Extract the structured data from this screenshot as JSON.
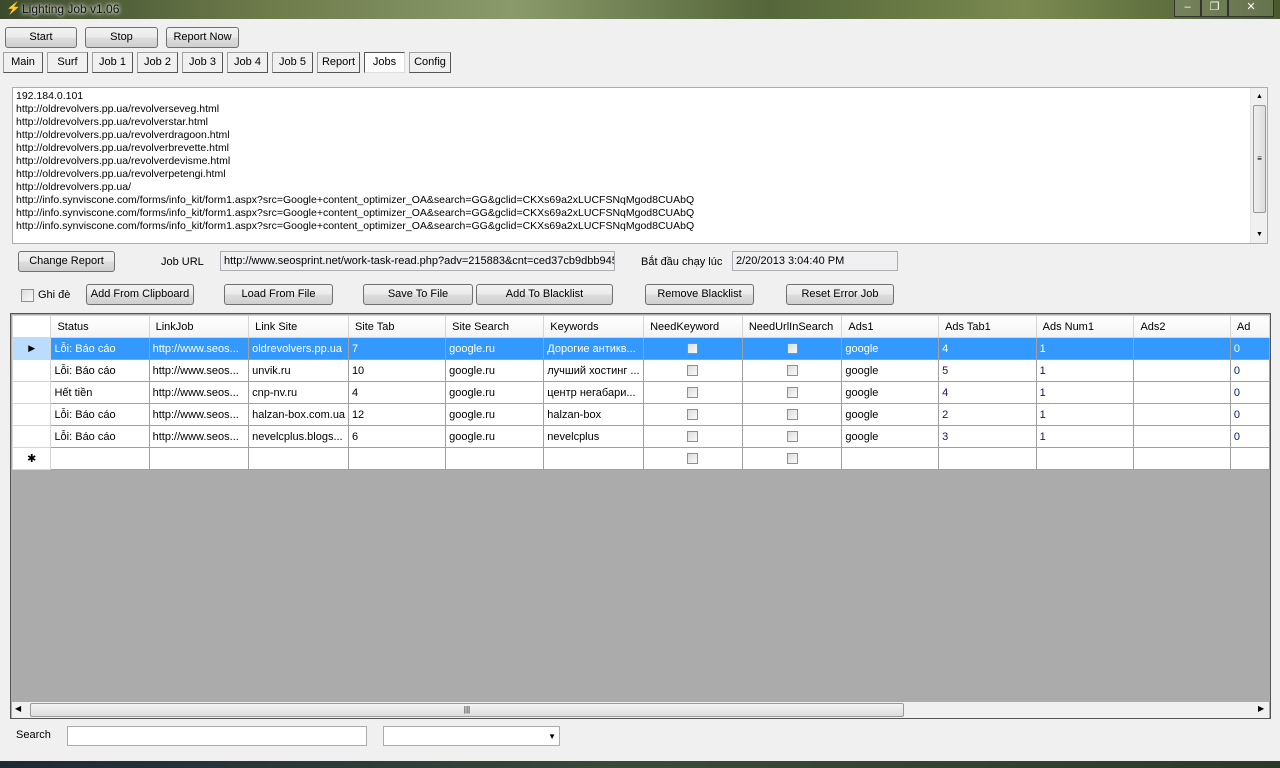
{
  "window": {
    "title": "Lighting Job v1.06",
    "min": "–",
    "max": "❐",
    "close": "✕"
  },
  "toolbar": {
    "start": "Start",
    "stop": "Stop",
    "report_now": "Report Now"
  },
  "tabs": [
    "Main",
    "Surf",
    "Job 1",
    "Job 2",
    "Job 3",
    "Job 4",
    "Job 5",
    "Report",
    "Jobs",
    "Config"
  ],
  "active_tab": "Jobs",
  "log_lines": [
    "192.184.0.101",
    "http://oldrevolvers.pp.ua/revolverseveg.html",
    "http://oldrevolvers.pp.ua/revolverstar.html",
    "http://oldrevolvers.pp.ua/revolverdragoon.html",
    "http://oldrevolvers.pp.ua/revolverbrevette.html",
    "http://oldrevolvers.pp.ua/revolverdevisme.html",
    "http://oldrevolvers.pp.ua/revolverpetengi.html",
    "http://oldrevolvers.pp.ua/",
    "http://info.synviscone.com/forms/info_kit/form1.aspx?src=Google+content_optimizer_OA&search=GG&gclid=CKXs69a2xLUCFSNqMgod8CUAbQ",
    "http://info.synviscone.com/forms/info_kit/form1.aspx?src=Google+content_optimizer_OA&search=GG&gclid=CKXs69a2xLUCFSNqMgod8CUAbQ",
    "http://info.synviscone.com/forms/info_kit/form1.aspx?src=Google+content_optimizer_OA&search=GG&gclid=CKXs69a2xLUCFSNqMgod8CUAbQ"
  ],
  "controls": {
    "change_report": "Change Report",
    "job_url_label": "Job URL",
    "job_url_value": "http://www.seosprint.net/work-task-read.php?adv=215883&cnt=ced37cb9dbb945",
    "start_label": "Bắt đầu chạy lúc",
    "start_value": "2/20/2013 3:04:40 PM",
    "overwrite_label": "Ghi đè",
    "add_clipboard": "Add From Clipboard",
    "load_file": "Load From File",
    "save_file": "Save To File",
    "add_blacklist": "Add To Blacklist",
    "remove_blacklist": "Remove Blacklist",
    "reset_error": "Reset Error Job"
  },
  "grid": {
    "columns": [
      "Status",
      "LinkJob",
      "Link Site",
      "Site Tab",
      "Site Search",
      "Keywords",
      "NeedKeyword",
      "NeedUrlInSearch",
      "Ads1",
      "Ads Tab1",
      "Ads Num1",
      "Ads2",
      "Ad"
    ],
    "rows": [
      [
        "Lỗi: Báo cáo",
        "http://www.seos...",
        "oldrevolvers.pp.ua",
        "7",
        "google.ru",
        "Дорогие антикв...",
        false,
        false,
        "google",
        "4",
        "1",
        "",
        "0"
      ],
      [
        "Lỗi: Báo cáo",
        "http://www.seos...",
        "unvik.ru",
        "10",
        "google.ru",
        "лучший хостинг ...",
        false,
        false,
        "google",
        "5",
        "1",
        "",
        "0"
      ],
      [
        "Hết tiền",
        "http://www.seos...",
        "cnp-nv.ru",
        "4",
        "google.ru",
        "центр негабари...",
        false,
        false,
        "google",
        "4",
        "1",
        "",
        "0"
      ],
      [
        "Lỗi: Báo cáo",
        "http://www.seos...",
        "halzan-box.com.ua",
        "12",
        "google.ru",
        "halzan-box",
        false,
        false,
        "google",
        "2",
        "1",
        "",
        "0"
      ],
      [
        "Lỗi: Báo cáo",
        "http://www.seos...",
        "nevelcplus.blogs...",
        "6",
        "google.ru",
        "nevelcplus",
        false,
        false,
        "google",
        "3",
        "1",
        "",
        "0"
      ]
    ],
    "selected_row": 0,
    "current_marker": "▶",
    "new_row_marker": "✱"
  },
  "search": {
    "label": "Search",
    "value": "",
    "combo_value": ""
  }
}
